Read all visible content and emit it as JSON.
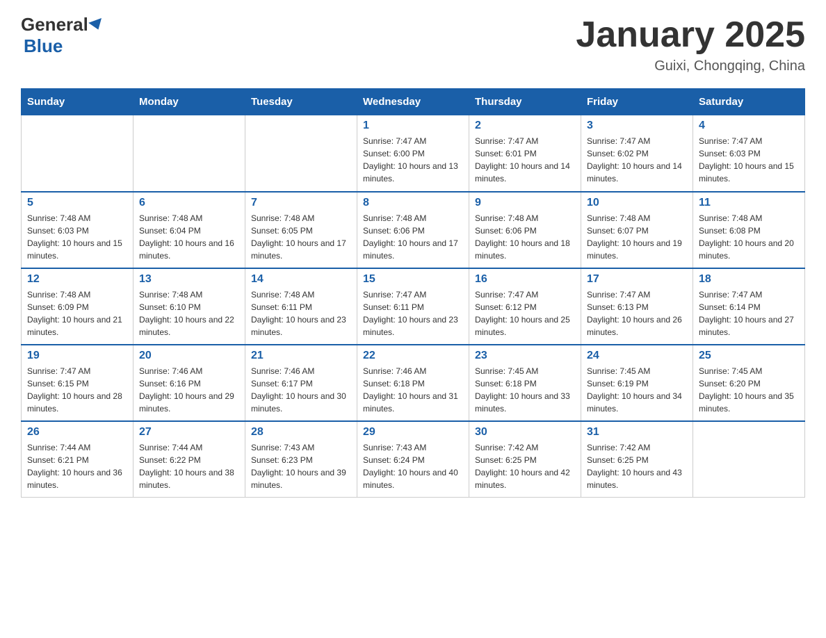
{
  "logo": {
    "general": "General",
    "blue": "Blue",
    "triangle": "▲"
  },
  "title": "January 2025",
  "location": "Guixi, Chongqing, China",
  "headers": [
    "Sunday",
    "Monday",
    "Tuesday",
    "Wednesday",
    "Thursday",
    "Friday",
    "Saturday"
  ],
  "weeks": [
    [
      {
        "day": "",
        "sunrise": "",
        "sunset": "",
        "daylight": ""
      },
      {
        "day": "",
        "sunrise": "",
        "sunset": "",
        "daylight": ""
      },
      {
        "day": "",
        "sunrise": "",
        "sunset": "",
        "daylight": ""
      },
      {
        "day": "1",
        "sunrise": "Sunrise: 7:47 AM",
        "sunset": "Sunset: 6:00 PM",
        "daylight": "Daylight: 10 hours and 13 minutes."
      },
      {
        "day": "2",
        "sunrise": "Sunrise: 7:47 AM",
        "sunset": "Sunset: 6:01 PM",
        "daylight": "Daylight: 10 hours and 14 minutes."
      },
      {
        "day": "3",
        "sunrise": "Sunrise: 7:47 AM",
        "sunset": "Sunset: 6:02 PM",
        "daylight": "Daylight: 10 hours and 14 minutes."
      },
      {
        "day": "4",
        "sunrise": "Sunrise: 7:47 AM",
        "sunset": "Sunset: 6:03 PM",
        "daylight": "Daylight: 10 hours and 15 minutes."
      }
    ],
    [
      {
        "day": "5",
        "sunrise": "Sunrise: 7:48 AM",
        "sunset": "Sunset: 6:03 PM",
        "daylight": "Daylight: 10 hours and 15 minutes."
      },
      {
        "day": "6",
        "sunrise": "Sunrise: 7:48 AM",
        "sunset": "Sunset: 6:04 PM",
        "daylight": "Daylight: 10 hours and 16 minutes."
      },
      {
        "day": "7",
        "sunrise": "Sunrise: 7:48 AM",
        "sunset": "Sunset: 6:05 PM",
        "daylight": "Daylight: 10 hours and 17 minutes."
      },
      {
        "day": "8",
        "sunrise": "Sunrise: 7:48 AM",
        "sunset": "Sunset: 6:06 PM",
        "daylight": "Daylight: 10 hours and 17 minutes."
      },
      {
        "day": "9",
        "sunrise": "Sunrise: 7:48 AM",
        "sunset": "Sunset: 6:06 PM",
        "daylight": "Daylight: 10 hours and 18 minutes."
      },
      {
        "day": "10",
        "sunrise": "Sunrise: 7:48 AM",
        "sunset": "Sunset: 6:07 PM",
        "daylight": "Daylight: 10 hours and 19 minutes."
      },
      {
        "day": "11",
        "sunrise": "Sunrise: 7:48 AM",
        "sunset": "Sunset: 6:08 PM",
        "daylight": "Daylight: 10 hours and 20 minutes."
      }
    ],
    [
      {
        "day": "12",
        "sunrise": "Sunrise: 7:48 AM",
        "sunset": "Sunset: 6:09 PM",
        "daylight": "Daylight: 10 hours and 21 minutes."
      },
      {
        "day": "13",
        "sunrise": "Sunrise: 7:48 AM",
        "sunset": "Sunset: 6:10 PM",
        "daylight": "Daylight: 10 hours and 22 minutes."
      },
      {
        "day": "14",
        "sunrise": "Sunrise: 7:48 AM",
        "sunset": "Sunset: 6:11 PM",
        "daylight": "Daylight: 10 hours and 23 minutes."
      },
      {
        "day": "15",
        "sunrise": "Sunrise: 7:47 AM",
        "sunset": "Sunset: 6:11 PM",
        "daylight": "Daylight: 10 hours and 23 minutes."
      },
      {
        "day": "16",
        "sunrise": "Sunrise: 7:47 AM",
        "sunset": "Sunset: 6:12 PM",
        "daylight": "Daylight: 10 hours and 25 minutes."
      },
      {
        "day": "17",
        "sunrise": "Sunrise: 7:47 AM",
        "sunset": "Sunset: 6:13 PM",
        "daylight": "Daylight: 10 hours and 26 minutes."
      },
      {
        "day": "18",
        "sunrise": "Sunrise: 7:47 AM",
        "sunset": "Sunset: 6:14 PM",
        "daylight": "Daylight: 10 hours and 27 minutes."
      }
    ],
    [
      {
        "day": "19",
        "sunrise": "Sunrise: 7:47 AM",
        "sunset": "Sunset: 6:15 PM",
        "daylight": "Daylight: 10 hours and 28 minutes."
      },
      {
        "day": "20",
        "sunrise": "Sunrise: 7:46 AM",
        "sunset": "Sunset: 6:16 PM",
        "daylight": "Daylight: 10 hours and 29 minutes."
      },
      {
        "day": "21",
        "sunrise": "Sunrise: 7:46 AM",
        "sunset": "Sunset: 6:17 PM",
        "daylight": "Daylight: 10 hours and 30 minutes."
      },
      {
        "day": "22",
        "sunrise": "Sunrise: 7:46 AM",
        "sunset": "Sunset: 6:18 PM",
        "daylight": "Daylight: 10 hours and 31 minutes."
      },
      {
        "day": "23",
        "sunrise": "Sunrise: 7:45 AM",
        "sunset": "Sunset: 6:18 PM",
        "daylight": "Daylight: 10 hours and 33 minutes."
      },
      {
        "day": "24",
        "sunrise": "Sunrise: 7:45 AM",
        "sunset": "Sunset: 6:19 PM",
        "daylight": "Daylight: 10 hours and 34 minutes."
      },
      {
        "day": "25",
        "sunrise": "Sunrise: 7:45 AM",
        "sunset": "Sunset: 6:20 PM",
        "daylight": "Daylight: 10 hours and 35 minutes."
      }
    ],
    [
      {
        "day": "26",
        "sunrise": "Sunrise: 7:44 AM",
        "sunset": "Sunset: 6:21 PM",
        "daylight": "Daylight: 10 hours and 36 minutes."
      },
      {
        "day": "27",
        "sunrise": "Sunrise: 7:44 AM",
        "sunset": "Sunset: 6:22 PM",
        "daylight": "Daylight: 10 hours and 38 minutes."
      },
      {
        "day": "28",
        "sunrise": "Sunrise: 7:43 AM",
        "sunset": "Sunset: 6:23 PM",
        "daylight": "Daylight: 10 hours and 39 minutes."
      },
      {
        "day": "29",
        "sunrise": "Sunrise: 7:43 AM",
        "sunset": "Sunset: 6:24 PM",
        "daylight": "Daylight: 10 hours and 40 minutes."
      },
      {
        "day": "30",
        "sunrise": "Sunrise: 7:42 AM",
        "sunset": "Sunset: 6:25 PM",
        "daylight": "Daylight: 10 hours and 42 minutes."
      },
      {
        "day": "31",
        "sunrise": "Sunrise: 7:42 AM",
        "sunset": "Sunset: 6:25 PM",
        "daylight": "Daylight: 10 hours and 43 minutes."
      },
      {
        "day": "",
        "sunrise": "",
        "sunset": "",
        "daylight": ""
      }
    ]
  ]
}
